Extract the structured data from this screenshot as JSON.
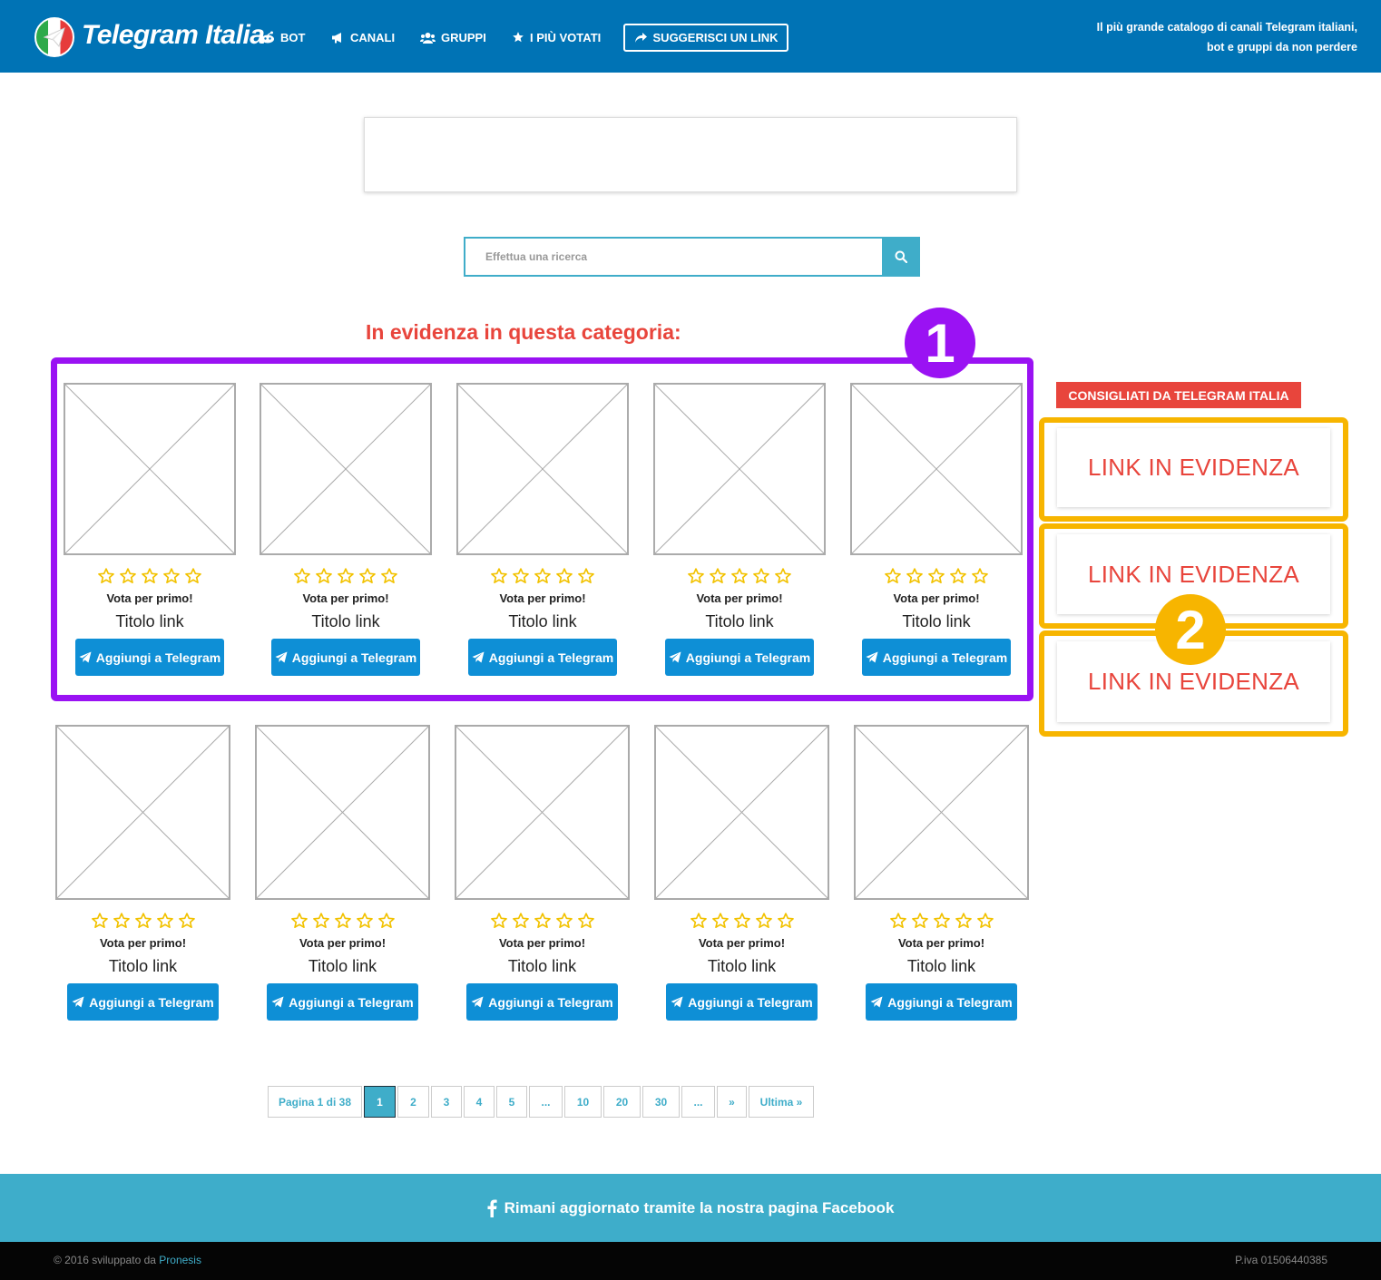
{
  "header": {
    "logo_text": "Telegram Italia",
    "nav": [
      {
        "label": "BOT",
        "icon": "reddit-robot-icon"
      },
      {
        "label": "CANALI",
        "icon": "megaphone-icon"
      },
      {
        "label": "GRUPPI",
        "icon": "users-icon"
      },
      {
        "label": "I PIÙ VOTATI",
        "icon": "star-icon"
      }
    ],
    "suggest_label": "SUGGERISCI UN LINK",
    "tagline_line1": "Il più grande catalogo di canali Telegram italiani,",
    "tagline_line2": "bot e gruppi da non perdere"
  },
  "search": {
    "placeholder": "Effettua una ricerca"
  },
  "featured": {
    "heading": "In evidenza in questa categoria:",
    "badge": "1",
    "cards": [
      {
        "vote": "Vota per primo!",
        "title": "Titolo link",
        "button": "Aggiungi a Telegram"
      },
      {
        "vote": "Vota per primo!",
        "title": "Titolo link",
        "button": "Aggiungi a Telegram"
      },
      {
        "vote": "Vota per primo!",
        "title": "Titolo link",
        "button": "Aggiungi a Telegram"
      },
      {
        "vote": "Vota per primo!",
        "title": "Titolo link",
        "button": "Aggiungi a Telegram"
      },
      {
        "vote": "Vota per primo!",
        "title": "Titolo link",
        "button": "Aggiungi a Telegram"
      }
    ]
  },
  "list": {
    "cards": [
      {
        "vote": "Vota per primo!",
        "title": "Titolo link",
        "button": "Aggiungi a Telegram"
      },
      {
        "vote": "Vota per primo!",
        "title": "Titolo link",
        "button": "Aggiungi a Telegram"
      },
      {
        "vote": "Vota per primo!",
        "title": "Titolo link",
        "button": "Aggiungi a Telegram"
      },
      {
        "vote": "Vota per primo!",
        "title": "Titolo link",
        "button": "Aggiungi a Telegram"
      },
      {
        "vote": "Vota per primo!",
        "title": "Titolo link",
        "button": "Aggiungi a Telegram"
      }
    ]
  },
  "sidebar": {
    "heading": "CONSIGLIATI DA TELEGRAM ITALIA",
    "badge": "2",
    "links": [
      "LINK IN EVIDENZA",
      "LINK IN EVIDENZA",
      "LINK IN EVIDENZA"
    ]
  },
  "pagination": {
    "info": "Pagina 1 di 38",
    "pages": [
      "1",
      "2",
      "3",
      "4",
      "5",
      "...",
      "10",
      "20",
      "30",
      "...",
      "»",
      "Ultima »"
    ],
    "active": "1"
  },
  "footer": {
    "facebook_text": "Rimani aggiornato tramite la nostra pagina Facebook",
    "copyright_prefix": "© 2016 sviluppato da",
    "developer": "Pronesis",
    "piva": "P.iva 01506440385"
  },
  "colors": {
    "header_bg": "#0073b5",
    "accent_red": "#e8453c",
    "button_blue": "#0e8fd6",
    "teal": "#3fadc9",
    "annotation_purple": "#9a12f3",
    "annotation_yellow": "#f7b500",
    "star_gold": "#f2c200"
  }
}
